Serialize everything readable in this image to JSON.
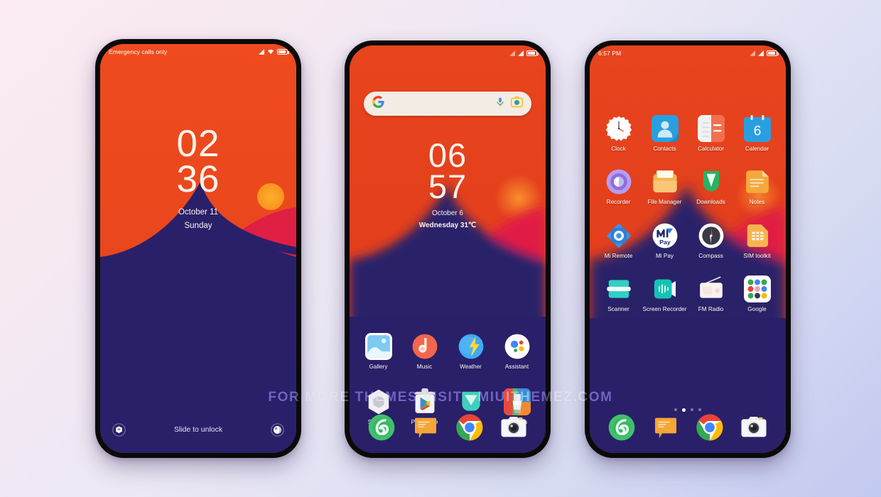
{
  "background": {
    "from": "#fbeaf2",
    "to": "#c2c9ef"
  },
  "watermark": {
    "text": "FOR MORE THEMES VISIT - MIUITHEMEZ.COM"
  },
  "wallpaper": {
    "sky": "#e8441d",
    "sky_top": "#ef4b1f",
    "mountain": "#2a2069",
    "slope": "#e01f44",
    "sun": "#f7941e"
  },
  "phone_lock": {
    "name": "lock-screen",
    "status": {
      "carrier": "Emergency calls only",
      "signal_icon": "signal-icon",
      "wifi_icon": "wifi-icon",
      "battery_icon": "battery-icon"
    },
    "clock": {
      "hours": "02",
      "minutes": "36"
    },
    "date": {
      "line1": "October 11",
      "line2": "Sunday"
    },
    "hint": "Slide to unlock",
    "left_icon": "flashlight-icon",
    "right_icon": "camera-icon"
  },
  "phone_home": {
    "name": "home-screen",
    "status": {
      "carrier": "",
      "signal_icon": "signal-icon",
      "signal2_icon": "signal-icon",
      "battery_icon": "battery-icon"
    },
    "search": {
      "logo_icon": "google-logo-icon",
      "mic_icon": "microphone-icon",
      "lens_icon": "google-lens-icon",
      "placeholder": ""
    },
    "clock": {
      "hours": "06",
      "minutes": "57"
    },
    "date": {
      "line1": "October 6",
      "line2": "Wednesday 31℃"
    },
    "apps_row1": [
      {
        "label": "Gallery",
        "icon": "gallery-icon"
      },
      {
        "label": "Music",
        "icon": "music-icon"
      },
      {
        "label": "Weather",
        "icon": "weather-icon"
      },
      {
        "label": "Assistant",
        "icon": "assistant-icon"
      }
    ],
    "apps_row2": [
      {
        "label": "Settings",
        "icon": "settings-icon"
      },
      {
        "label": "Play Store",
        "icon": "play-store-icon"
      },
      {
        "label": "Security",
        "icon": "security-icon"
      },
      {
        "label": "Themes",
        "icon": "themes-icon"
      }
    ],
    "dock": [
      {
        "label": "Phone",
        "icon": "phone-icon"
      },
      {
        "label": "Messages",
        "icon": "messages-icon"
      },
      {
        "label": "Chrome",
        "icon": "chrome-icon"
      },
      {
        "label": "Camera",
        "icon": "camera-app-icon"
      }
    ]
  },
  "phone_drawer": {
    "name": "app-drawer-screen",
    "status": {
      "time": "6:57 PM",
      "signal_icon": "signal-icon",
      "signal2_icon": "signal-icon",
      "battery_icon": "battery-icon"
    },
    "apps": [
      {
        "label": "Clock",
        "icon": "clock-icon"
      },
      {
        "label": "Contacts",
        "icon": "contacts-icon"
      },
      {
        "label": "Calculator",
        "icon": "calculator-icon"
      },
      {
        "label": "Calendar",
        "icon": "calendar-icon",
        "badge": "6"
      },
      {
        "label": "Recorder",
        "icon": "recorder-icon"
      },
      {
        "label": "File Manager",
        "icon": "file-manager-icon"
      },
      {
        "label": "Downloads",
        "icon": "downloads-icon"
      },
      {
        "label": "Notes",
        "icon": "notes-icon"
      },
      {
        "label": "Mi Remote",
        "icon": "mi-remote-icon"
      },
      {
        "label": "Mi Pay",
        "icon": "mi-pay-icon"
      },
      {
        "label": "Compass",
        "icon": "compass-icon"
      },
      {
        "label": "SIM toolkit",
        "icon": "sim-toolkit-icon"
      },
      {
        "label": "Scanner",
        "icon": "scanner-icon"
      },
      {
        "label": "Screen Recorder",
        "icon": "screen-recorder-icon"
      },
      {
        "label": "FM Radio",
        "icon": "fm-radio-icon"
      },
      {
        "label": "Google",
        "icon": "google-folder-icon"
      }
    ],
    "page_dots": {
      "count": 4,
      "active": 1
    },
    "dock": [
      {
        "label": "Phone",
        "icon": "phone-icon"
      },
      {
        "label": "Messages",
        "icon": "messages-icon"
      },
      {
        "label": "Chrome",
        "icon": "chrome-icon"
      },
      {
        "label": "Camera",
        "icon": "camera-app-icon"
      }
    ]
  }
}
